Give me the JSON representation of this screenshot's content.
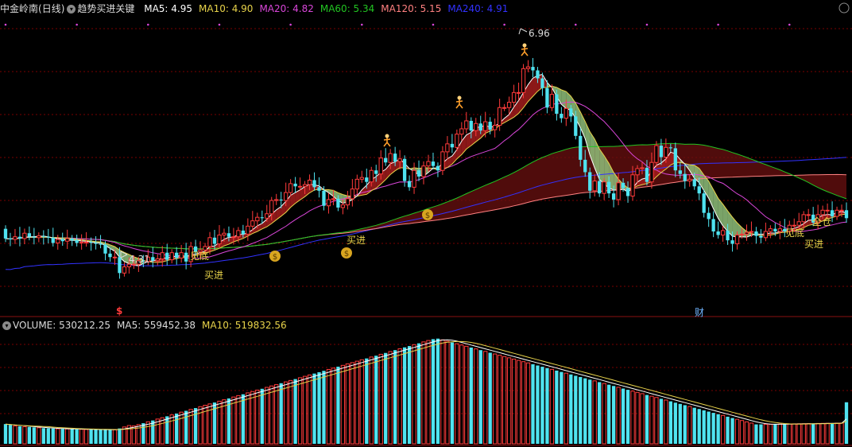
{
  "header": {
    "name": "中金岭南",
    "period": "(日线)",
    "indicator": "趋势买进关键",
    "ma": [
      {
        "label": "MA5:",
        "value": "4.95",
        "color": "#ffffff"
      },
      {
        "label": "MA10:",
        "value": "4.90",
        "color": "#e8d34a"
      },
      {
        "label": "MA20:",
        "value": "4.82",
        "color": "#d946d9"
      },
      {
        "label": "MA60:",
        "value": "5.34",
        "color": "#22c522"
      },
      {
        "label": "MA120:",
        "value": "5.15",
        "color": "#ff8080"
      },
      {
        "label": "MA240:",
        "value": "4.91",
        "color": "#3232ff"
      }
    ]
  },
  "volume_header": {
    "label": "VOLUME:",
    "value": "530212.25",
    "ma5_label": "MA5:",
    "ma5_value": "559452.38",
    "ma10_label": "MA10:",
    "ma10_value": "519832.56"
  },
  "annotations": {
    "low_price": "4.31",
    "high_price": "6.96",
    "bottom_1": "见底",
    "buy_1": "买进",
    "buy_2": "买进",
    "bottom_2": "见底",
    "full_position": "全仓",
    "buy_3": "买进",
    "dividend_marker": "$",
    "finance_marker": "财"
  },
  "colors": {
    "up": "#ff3b3b",
    "down": "#4fe3f0",
    "ma5": "#ffffff",
    "ma10": "#e8d34a",
    "ma20": "#d946d9",
    "ma60": "#22c522",
    "ma120": "#ff8080",
    "ma240": "#3232ff",
    "grid": "#7a0000",
    "band_fill": "#6b1010",
    "band_green": "#8fbf7a"
  },
  "chart_data": [
    {
      "type": "candlestick",
      "title": "中金岭南 (日线)",
      "ylim": [
        4.0,
        7.2
      ],
      "x": [
        1,
        2,
        3,
        4,
        5,
        6,
        7,
        8,
        9,
        10,
        11,
        12,
        13,
        14,
        15,
        16,
        17,
        18,
        19,
        20,
        21,
        22,
        23,
        24,
        25,
        26,
        27,
        28,
        29,
        30,
        31,
        32,
        33,
        34,
        35,
        36,
        37,
        38,
        39,
        40,
        41,
        42,
        43,
        44,
        45,
        46,
        47,
        48,
        49,
        50,
        51,
        52,
        53,
        54,
        55,
        56,
        57,
        58,
        59,
        60,
        61,
        62,
        63,
        64,
        65,
        66,
        67,
        68,
        69,
        70,
        71,
        72,
        73,
        74,
        75,
        76,
        77,
        78,
        79,
        80,
        81,
        82,
        83,
        84,
        85,
        86,
        87,
        88,
        89,
        90,
        91,
        92,
        93,
        94,
        95,
        96,
        97,
        98,
        99,
        100,
        101,
        102,
        103,
        104,
        105,
        106,
        107,
        108,
        109,
        110,
        111,
        112,
        113,
        114,
        115,
        116,
        117,
        118,
        119,
        120,
        121,
        122,
        123,
        124,
        125,
        126,
        127,
        128,
        129,
        130,
        131,
        132,
        133,
        134,
        135,
        136,
        137,
        138,
        139,
        140,
        141,
        142,
        143,
        144,
        145,
        146,
        147,
        148,
        149,
        150,
        151,
        152,
        153,
        154,
        155,
        156,
        157,
        158,
        159,
        160,
        161,
        162,
        163,
        164,
        165,
        166,
        167,
        168,
        169,
        170,
        171,
        172,
        173,
        174,
        175,
        176,
        177,
        178
      ],
      "open": [
        4.83,
        4.72,
        4.71,
        4.74,
        4.72,
        4.78,
        4.74,
        4.73,
        4.75,
        4.74,
        4.73,
        4.67,
        4.71,
        4.69,
        4.72,
        4.7,
        4.67,
        4.68,
        4.68,
        4.67,
        4.66,
        4.65,
        4.55,
        4.51,
        4.51,
        4.33,
        4.4,
        4.43,
        4.43,
        4.47,
        4.46,
        4.51,
        4.47,
        4.49,
        4.56,
        4.48,
        4.56,
        4.5,
        4.56,
        4.46,
        4.63,
        4.57,
        4.59,
        4.63,
        4.73,
        4.66,
        4.76,
        4.78,
        4.74,
        4.74,
        4.81,
        4.77,
        4.86,
        4.92,
        4.96,
        4.95,
        5.0,
        5.15,
        5.16,
        5.15,
        5.24,
        5.34,
        5.31,
        5.31,
        5.33,
        5.38,
        5.3,
        5.26,
        5.09,
        5.16,
        5.17,
        5.07,
        5.1,
        5.17,
        5.28,
        5.39,
        5.41,
        5.36,
        5.49,
        5.45,
        5.63,
        5.58,
        5.68,
        5.59,
        5.62,
        5.37,
        5.3,
        5.49,
        5.42,
        5.54,
        5.59,
        5.54,
        5.49,
        5.7,
        5.79,
        5.75,
        5.9,
        5.96,
        6.05,
        5.94,
        6.02,
        5.94,
        6.04,
        5.95,
        6.0,
        6.2,
        6.2,
        6.26,
        6.37,
        6.37,
        6.64,
        6.66,
        6.62,
        6.53,
        6.42,
        6.2,
        6.35,
        6.13,
        6.08,
        6.19,
        6.1,
        5.88,
        5.61,
        5.47,
        5.26,
        5.37,
        5.23,
        5.36,
        5.23,
        5.16,
        5.35,
        5.29,
        5.2,
        5.44,
        5.51,
        5.52,
        5.36,
        5.58,
        5.77,
        5.64,
        5.75,
        5.74,
        5.49,
        5.45,
        5.37,
        5.39,
        5.31,
        5.23,
        5.01,
        4.94,
        4.8,
        4.76,
        4.81,
        4.7,
        4.66,
        4.76,
        4.77,
        4.79,
        4.8,
        4.75,
        4.73,
        4.8,
        4.83,
        4.8,
        4.83,
        4.8,
        4.87,
        4.87,
        4.91,
        4.99,
        4.99,
        4.9,
        4.99,
        5.04,
        5.04,
        4.97,
        5.04,
        5.04
      ],
      "close": [
        4.72,
        4.71,
        4.74,
        4.72,
        4.78,
        4.74,
        4.73,
        4.75,
        4.74,
        4.73,
        4.67,
        4.71,
        4.69,
        4.72,
        4.7,
        4.67,
        4.68,
        4.68,
        4.67,
        4.66,
        4.65,
        4.55,
        4.51,
        4.51,
        4.33,
        4.4,
        4.43,
        4.43,
        4.47,
        4.46,
        4.51,
        4.47,
        4.49,
        4.56,
        4.48,
        4.56,
        4.5,
        4.56,
        4.46,
        4.63,
        4.57,
        4.59,
        4.63,
        4.73,
        4.66,
        4.76,
        4.78,
        4.74,
        4.74,
        4.81,
        4.77,
        4.86,
        4.92,
        4.96,
        4.95,
        5.0,
        5.15,
        5.16,
        5.15,
        5.24,
        5.34,
        5.31,
        5.31,
        5.33,
        5.38,
        5.3,
        5.26,
        5.09,
        5.16,
        5.17,
        5.07,
        5.1,
        5.17,
        5.28,
        5.39,
        5.41,
        5.36,
        5.49,
        5.45,
        5.63,
        5.58,
        5.68,
        5.59,
        5.62,
        5.37,
        5.3,
        5.49,
        5.42,
        5.54,
        5.59,
        5.54,
        5.49,
        5.7,
        5.79,
        5.75,
        5.9,
        5.96,
        6.05,
        5.94,
        6.02,
        5.94,
        6.04,
        5.95,
        6.0,
        6.2,
        6.2,
        6.26,
        6.37,
        6.37,
        6.64,
        6.66,
        6.62,
        6.53,
        6.42,
        6.2,
        6.35,
        6.13,
        6.08,
        6.19,
        6.1,
        5.88,
        5.61,
        5.47,
        5.26,
        5.37,
        5.23,
        5.36,
        5.23,
        5.16,
        5.35,
        5.29,
        5.2,
        5.44,
        5.51,
        5.52,
        5.36,
        5.58,
        5.77,
        5.64,
        5.75,
        5.74,
        5.49,
        5.45,
        5.37,
        5.39,
        5.31,
        5.23,
        5.01,
        4.94,
        4.8,
        4.76,
        4.81,
        4.7,
        4.66,
        4.76,
        4.77,
        4.79,
        4.8,
        4.75,
        4.73,
        4.8,
        4.83,
        4.8,
        4.83,
        4.8,
        4.87,
        4.87,
        4.91,
        4.99,
        4.99,
        4.9,
        4.99,
        5.04,
        5.04,
        4.97,
        5.04,
        5.04,
        4.95
      ],
      "low_annotation": "4.31",
      "high_annotation": "6.96"
    },
    {
      "type": "bar",
      "title": "VOLUME",
      "ylim": [
        0,
        1400000
      ],
      "values": [
        252000,
        241000,
        228000,
        223000,
        218000,
        215000,
        210000,
        205000,
        200000,
        198000,
        195000,
        192000,
        191000,
        190000,
        188000,
        186000,
        185000,
        183000,
        182000,
        181000,
        180000,
        180000,
        179000,
        178000,
        196000,
        215000,
        233000,
        228000,
        245000,
        263000,
        281000,
        298000,
        316000,
        333000,
        351000,
        369000,
        386000,
        404000,
        421000,
        439000,
        456000,
        474000,
        492000,
        509000,
        527000,
        544000,
        562000,
        579000,
        597000,
        615000,
        632000,
        650000,
        667000,
        685000,
        702000,
        720000,
        738000,
        755000,
        773000,
        790000,
        808000,
        826000,
        843000,
        861000,
        878000,
        896000,
        913000,
        931000,
        949000,
        966000,
        984000,
        1001000,
        1019000,
        1036000,
        1054000,
        1072000,
        1089000,
        1107000,
        1124000,
        1142000,
        1159000,
        1177000,
        1195000,
        1212000,
        1230000,
        1247000,
        1265000,
        1282000,
        1300000,
        1318000,
        1335000,
        1342000,
        1326000,
        1309000,
        1293000,
        1277000,
        1260000,
        1244000,
        1228000,
        1211000,
        1195000,
        1179000,
        1162000,
        1146000,
        1130000,
        1113000,
        1097000,
        1081000,
        1064000,
        1048000,
        1032000,
        1015000,
        999000,
        983000,
        966000,
        950000,
        934000,
        917000,
        901000,
        885000,
        868000,
        852000,
        836000,
        819000,
        803000,
        787000,
        770000,
        754000,
        738000,
        721000,
        705000,
        689000,
        672000,
        656000,
        640000,
        623000,
        607000,
        591000,
        574000,
        558000,
        542000,
        525000,
        509000,
        493000,
        476000,
        460000,
        444000,
        427000,
        411000,
        395000,
        378000,
        362000,
        346000,
        329000,
        313000,
        297000,
        280000,
        264000,
        248000,
        248000,
        249000,
        250000,
        251000,
        252000,
        253000,
        254000,
        255000,
        256000,
        257000,
        258000,
        259000,
        260000,
        261000,
        262000,
        263000,
        264000,
        265000,
        530212
      ]
    }
  ]
}
